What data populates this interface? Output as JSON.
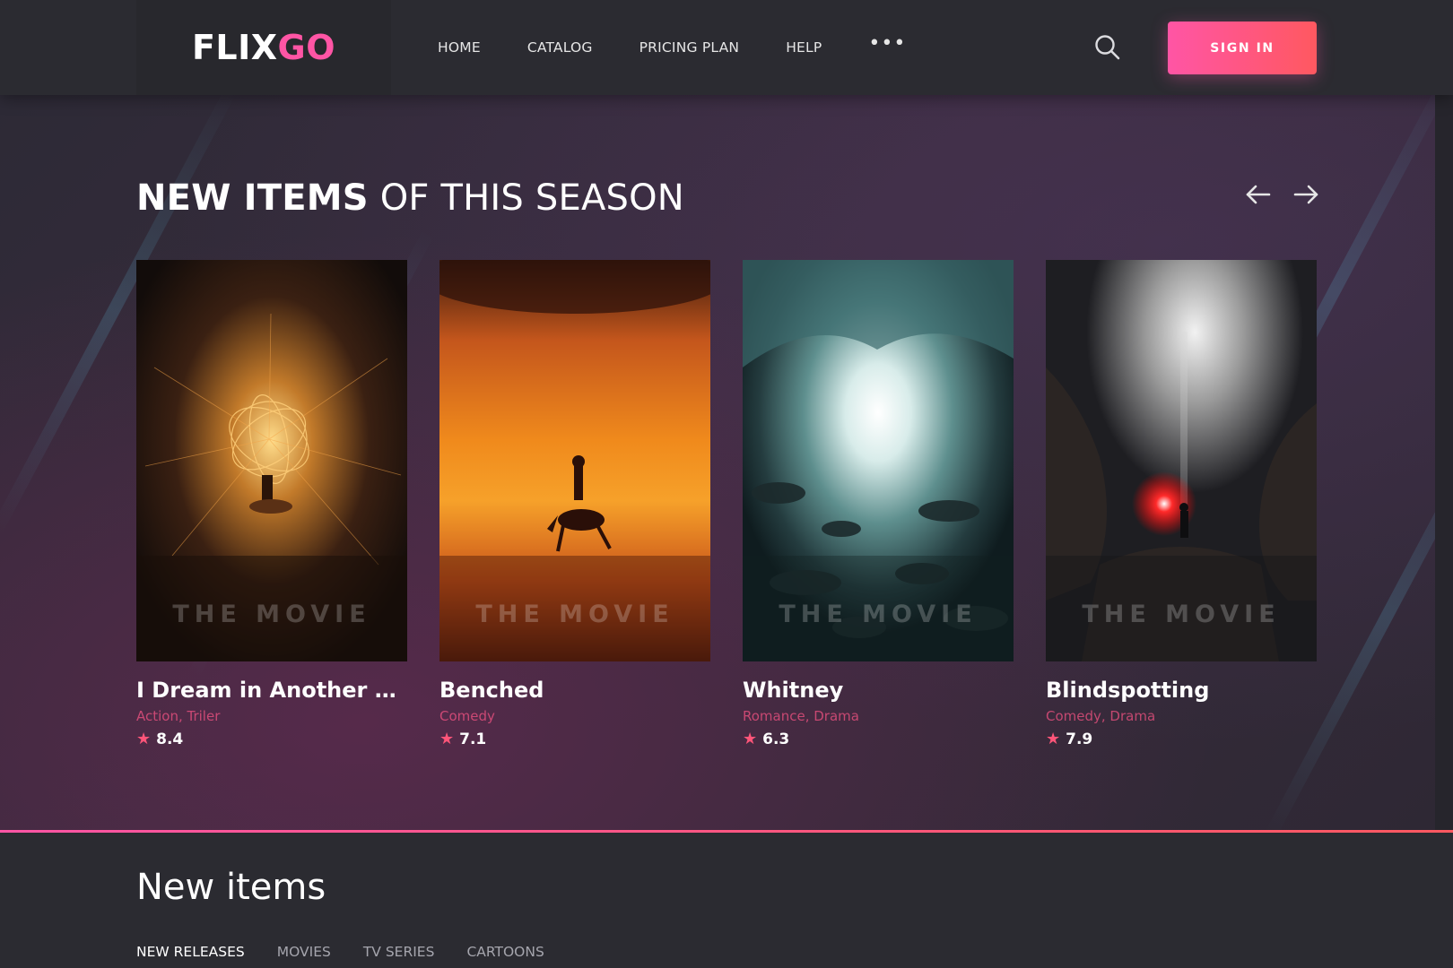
{
  "header": {
    "logo_part1": "FLIX",
    "logo_part2": "GO",
    "nav": [
      "HOME",
      "CATALOG",
      "PRICING PLAN",
      "HELP"
    ],
    "more_label": "•••",
    "search_icon": "search-icon",
    "signin_label": "SIGN IN"
  },
  "hero": {
    "title_bold": "NEW ITEMS",
    "title_light": "OF THIS SEASON",
    "prev_icon": "arrow-left-icon",
    "next_icon": "arrow-right-icon",
    "cards": [
      {
        "title": "I Dream in Another Lan...",
        "genre": "Action, Triler",
        "rating": "8.4",
        "poster_text": "THE MOVIE"
      },
      {
        "title": "Benched",
        "genre": "Comedy",
        "rating": "7.1",
        "poster_text": "THE MOVIE"
      },
      {
        "title": "Whitney",
        "genre": "Romance, Drama",
        "rating": "6.3",
        "poster_text": "THE MOVIE"
      },
      {
        "title": "Blindspotting",
        "genre": "Comedy, Drama",
        "rating": "7.9",
        "poster_text": "THE MOVIE"
      }
    ]
  },
  "section": {
    "title": "New items",
    "tabs": [
      "NEW RELEASES",
      "MOVIES",
      "TV SERIES",
      "CARTOONS"
    ],
    "active_tab": "NEW RELEASES"
  },
  "colors": {
    "accent_pink": "#ff55a5",
    "accent_red": "#ff5860",
    "background": "#2b2b31"
  }
}
